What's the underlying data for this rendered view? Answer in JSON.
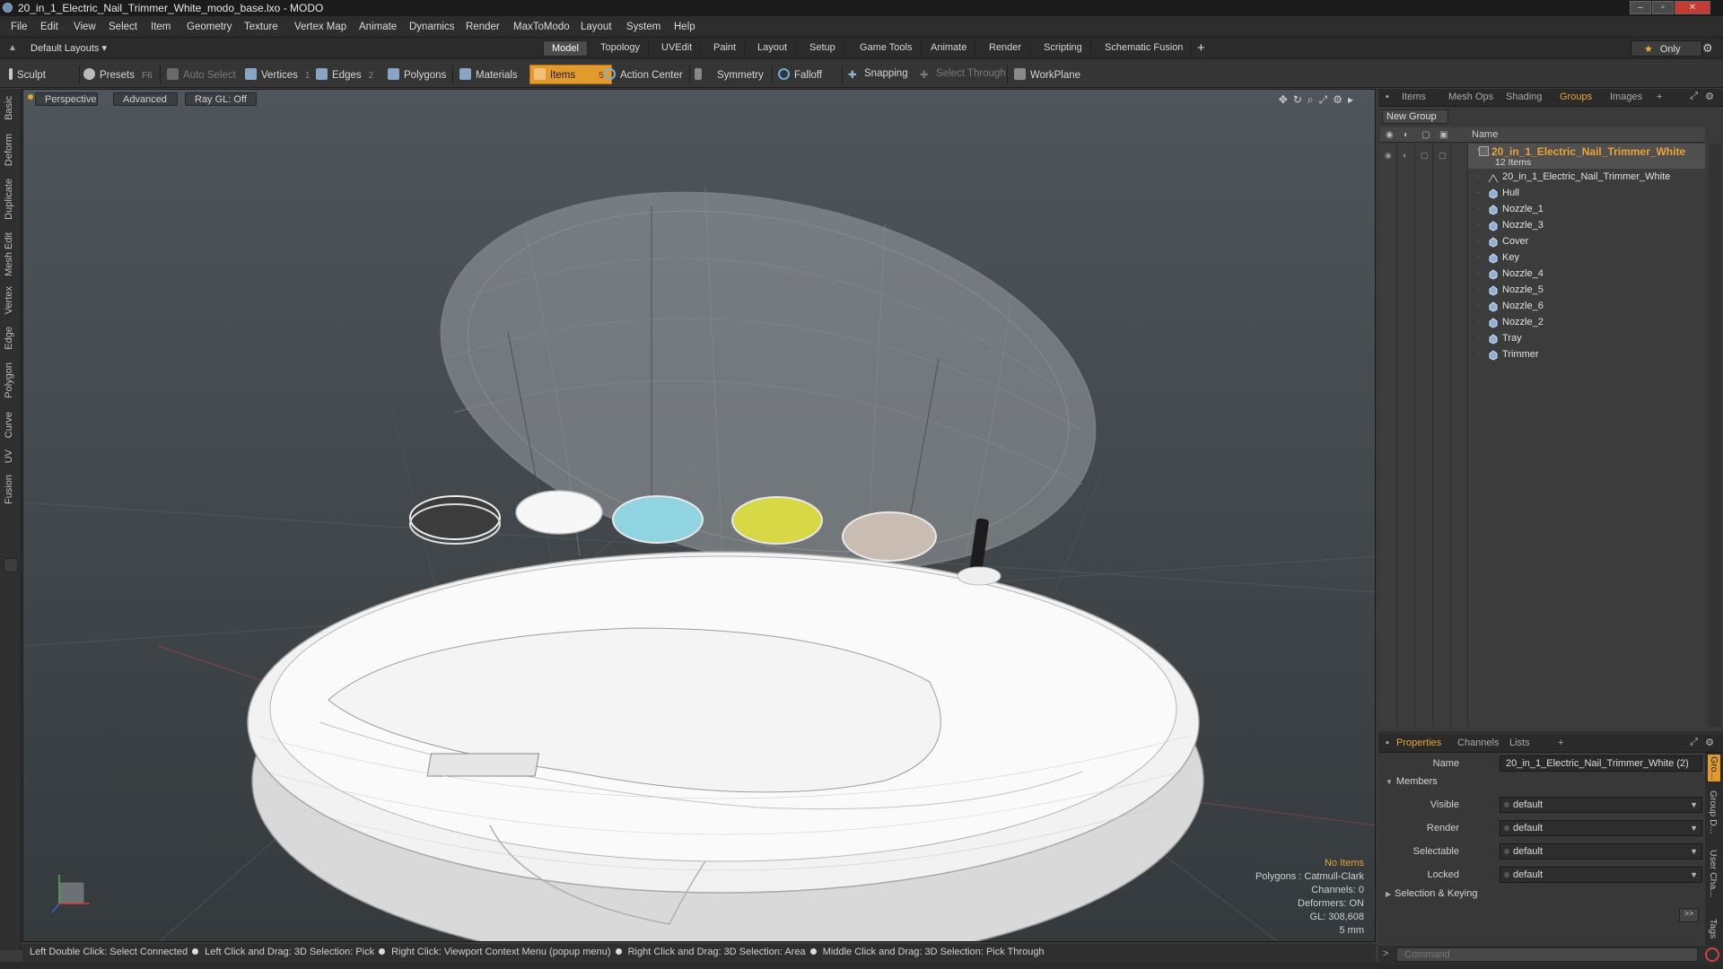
{
  "window": {
    "title": "20_in_1_Electric_Nail_Trimmer_White_modo_base.lxo - MODO"
  },
  "menubar": {
    "items": [
      "File",
      "Edit",
      "View",
      "Select",
      "Item",
      "Geometry",
      "Texture",
      "Vertex Map",
      "Animate",
      "Dynamics",
      "Render",
      "MaxToModo",
      "Layout",
      "System",
      "Help"
    ]
  },
  "layoutbar": {
    "layout_menu": "Default Layouts ▾",
    "tabs": [
      "Model",
      "Topology",
      "UVEdit",
      "Paint",
      "Layout",
      "Setup",
      "Game Tools",
      "Animate",
      "Render",
      "Scripting",
      "Schematic Fusion"
    ],
    "active_tab": "Model",
    "only_label": "Only"
  },
  "toolbar": {
    "sculpt": "Sculpt",
    "presets": "Presets",
    "presets_key": "F6",
    "auto_select": "Auto Select",
    "vertices": "Vertices",
    "vertices_count": "1",
    "edges": "Edges",
    "edges_count": "2",
    "polygons": "Polygons",
    "materials": "Materials",
    "items": "Items",
    "items_count": "5",
    "action_center": "Action Center",
    "symmetry": "Symmetry",
    "falloff": "Falloff",
    "snapping": "Snapping",
    "select_through": "Select Through",
    "workplane": "WorkPlane"
  },
  "left_tabs": [
    "Basic",
    "Deform",
    "Duplicate",
    "Mesh Edit",
    "Vertex",
    "Edge",
    "Polygon",
    "Curve",
    "UV",
    "Fusion"
  ],
  "viewport": {
    "view_mode": "Perspective",
    "shading": "Advanced",
    "raygl": "Ray GL: Off",
    "info": {
      "no_items": "No Items",
      "polygons": "Polygons : Catmull-Clark",
      "channels": "Channels: 0",
      "deformers": "Deformers: ON",
      "gl": "GL: 308,608",
      "unit": "5 mm"
    }
  },
  "statusbar": {
    "hints": [
      "Left Double Click: Select Connected",
      "Left Click and Drag: 3D Selection: Pick",
      "Right Click: Viewport Context Menu (popup menu)",
      "Right Click and Drag: 3D Selection: Area",
      "Middle Click and Drag: 3D Selection: Pick Through"
    ]
  },
  "groups_panel": {
    "tabs": [
      "Items",
      "Mesh Ops",
      "Shading",
      "Groups",
      "Images",
      "+"
    ],
    "active_tab": "Groups",
    "new_group": "New Group",
    "name_header": "Name",
    "group_name": "20_in_1_Electric_Nail_Trimmer_White",
    "group_count": "12 Items",
    "items": [
      "20_in_1_Electric_Nail_Trimmer_White",
      "Hull",
      "Nozzle_1",
      "Nozzle_3",
      "Cover",
      "Key",
      "Nozzle_4",
      "Nozzle_5",
      "Nozzle_6",
      "Nozzle_2",
      "Tray",
      "Trimmer"
    ]
  },
  "properties_panel": {
    "tabs": [
      "Properties",
      "Channels",
      "Lists",
      "+"
    ],
    "active_tab": "Properties",
    "name_label": "Name",
    "name_value": "20_in_1_Electric_Nail_Trimmer_White (2)",
    "members_section": "Members",
    "visible_label": "Visible",
    "visible_value": "default",
    "render_label": "Render",
    "render_value": "default",
    "selectable_label": "Selectable",
    "selectable_value": "default",
    "locked_label": "Locked",
    "locked_value": "default",
    "selection_section": "Selection & Keying",
    "side_tabs": [
      "Gro...",
      "Group D...",
      "User Cha...",
      "Tags"
    ]
  },
  "command": {
    "placeholder": "Command"
  }
}
